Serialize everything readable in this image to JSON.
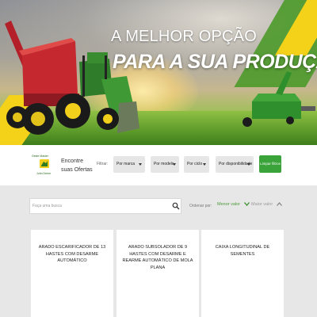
{
  "hero": {
    "line1": "A MELHOR OPÇÃO",
    "line2": "PARA A SUA PRODUÇÃO"
  },
  "brand": {
    "top_text": "Oeste Máster",
    "bottom_text": "John Deere"
  },
  "filters": {
    "intro": "Encontre suas Ofertas",
    "label": "Filtrar:",
    "selects": [
      {
        "label": "Por marca"
      },
      {
        "label": "Por modelo"
      },
      {
        "label": "Por ciclo"
      },
      {
        "label": "Por disponibilidade"
      }
    ],
    "clear_label": "Limpar filtros"
  },
  "search": {
    "placeholder": "Faça uma busca"
  },
  "sort": {
    "label": "Ordenar por:",
    "lower": "Menor valor",
    "higher": "Maior valor"
  },
  "colors": {
    "accent_green": "#3aa33a",
    "brand_yellow": "#f5d21a"
  },
  "cards": [
    {
      "title": "ARADO ESCARIFICADOR DE 13 HASTES COM DESARME AUTOMÁTICO"
    },
    {
      "title": "ARADO SUBSOLADOR DE 9 HASTES COM DESARME E REARME AUTOMÁTICO DE MOLA PLANA"
    },
    {
      "title": "CAIXA LONGITUDINAL DE SEMENTES"
    }
  ]
}
